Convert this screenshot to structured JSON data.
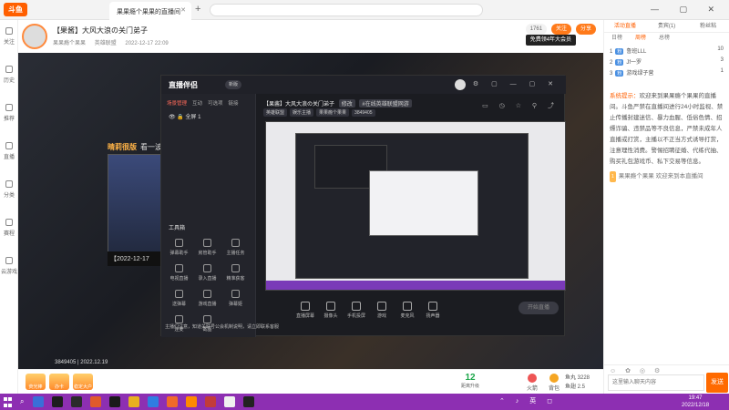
{
  "browser": {
    "logo": "斗鱼",
    "tab_title": "果果瘾个果果的直播间",
    "address_placeholder": "",
    "window_controls": "— ▢ ✕"
  },
  "leftnav": [
    {
      "label": "关注",
      "icon": "heart-icon"
    },
    {
      "label": "历史",
      "icon": "clock-icon"
    },
    {
      "label": "推荐",
      "icon": "home-icon"
    },
    {
      "label": "直播",
      "icon": "tv-icon"
    },
    {
      "label": "分类",
      "icon": "grid-icon"
    },
    {
      "label": "赛程",
      "icon": "trophy-icon"
    },
    {
      "label": "云游戏",
      "icon": "cloud-game-icon"
    }
  ],
  "header": {
    "title": "【果酱】大风大浪の关门弟子",
    "date": "2022-12-17 22:09",
    "streamer": "果果瘾个果果",
    "category": "英雄联盟",
    "follows": "1761",
    "follow_label": "关注",
    "share_label": "分享",
    "free_label": "免费领4年大会员"
  },
  "video": {
    "overlay_name": "晴莉很版",
    "overlay_text": "看一波~",
    "thumb_caption": "【2022-12-17",
    "footer": "3849405 | 2022.12.19"
  },
  "app": {
    "brand": "直播伴侣",
    "version": "新版",
    "side_tabs": [
      "场景管理",
      "互动",
      "可选项",
      "链接"
    ],
    "scene": "全屏 1",
    "tools_label": "工具箱",
    "tools": [
      "弹幕助手",
      "房管助手",
      "主播任务",
      "电视直播",
      "录入直播",
      "精准获客",
      "送弹幕",
      "游戏直播",
      "弹幕姬",
      "连麦",
      "截图"
    ],
    "notice": "主播们注意，知道关联号公会机制说明，请立即联系客服",
    "room_title": "【果酱】大风大浪の关门弟子",
    "room_tag": "修改",
    "room_category": "#在线英雄联盟网游",
    "room_subtags": [
      "英雄联盟",
      "娱乐主播",
      "果果瘾个果果"
    ],
    "room_id": "3849405",
    "controls": [
      "直播屏幕",
      "摄像头",
      "手机投屏",
      "游戏",
      "麦克风",
      "扬声器"
    ],
    "start_label": "开始直播"
  },
  "giftbar": {
    "gifts": [
      "荧光棒",
      "办卡",
      "稳定大户"
    ],
    "level_num": "12",
    "level_label": "距离升级",
    "btn1": "火箭",
    "btn2": "背包",
    "stat1": "鱼丸 3228",
    "stat2": "鱼翅 2.5"
  },
  "rightpanel": {
    "tabs": [
      "活动直播",
      "贵宾(1)",
      "粉丝粘",
      "找伴"
    ],
    "subtabs": [
      "日榜",
      "周榜",
      "总榜"
    ],
    "ranks": [
      {
        "name": "鲁班LLL",
        "val": "10"
      },
      {
        "name": "Jf一罗",
        "val": "3"
      },
      {
        "name": "游戏绿子营",
        "val": "1"
      }
    ],
    "system_label": "系统提示：",
    "system_text": "欢迎来到果果瘾个果果的直播间。斗鱼严禁在直播间进行24小时监视、禁止传播封建迷信、暴力血腥、低俗色情、招嫖诈骗、违禁品等不良信息，严禁未成年人直播或打赏，主播以不正当方式诱导打赏，注意理性消费。警惕招聘征婚、代练代抽、购买礼包游戏币、私下交易等信息。",
    "welcome_badge": "1",
    "welcome_text": "果果瘾个果果 欢迎来到本直播间",
    "input_placeholder": "这里输入聊天内容",
    "send_label": "发送"
  },
  "taskbar": {
    "time": "19:47",
    "date": "2022/12/18",
    "tray": "⌃ ♪ 英 ◻"
  },
  "colors": {
    "brand_orange": "#ff5f00",
    "taskbar_purple": "#8d2fb2",
    "level_green": "#1ca64a"
  }
}
